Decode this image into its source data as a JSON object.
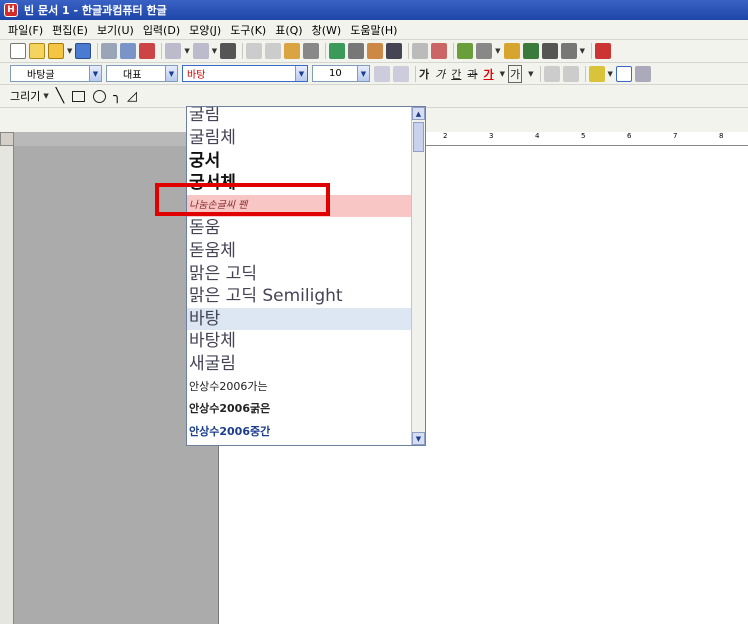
{
  "window": {
    "title": "빈 문서 1 - 한글과컴퓨터 한글"
  },
  "menu": [
    "파일(F)",
    "편집(E)",
    "보기(U)",
    "입력(D)",
    "모양(J)",
    "도구(K)",
    "표(Q)",
    "창(W)",
    "도움말(H)"
  ],
  "format_toolbar": {
    "style": "바탕글",
    "lang": "대표",
    "font": "바탕",
    "size": "10",
    "bold": "가",
    "italic": "가",
    "underline": "간",
    "strike": "과",
    "color": "가",
    "outline": "가"
  },
  "draw_toolbar": {
    "label": "그리기"
  },
  "ruler_numbers": [
    "2",
    "3",
    "4",
    "5",
    "6",
    "7",
    "8"
  ],
  "font_list": [
    {
      "name": "굴림"
    },
    {
      "name": "굴림체"
    },
    {
      "name": "궁서"
    },
    {
      "name": "궁서체"
    },
    {
      "name": "나눔손글씨 펜"
    },
    {
      "name": "돋움"
    },
    {
      "name": "돋움체"
    },
    {
      "name": "맑은 고딕"
    },
    {
      "name": "맑은 고딕 Semilight"
    },
    {
      "name": "바탕"
    },
    {
      "name": "바탕체"
    },
    {
      "name": "새굴림"
    },
    {
      "name": "안상수2006가는"
    },
    {
      "name": "안상수2006굵은"
    },
    {
      "name": "안상수2006중간"
    }
  ],
  "highlight": {
    "annotation_color": "#e00000",
    "selected_color": "#dde6f3",
    "hover_color": "#f9c6c6"
  }
}
